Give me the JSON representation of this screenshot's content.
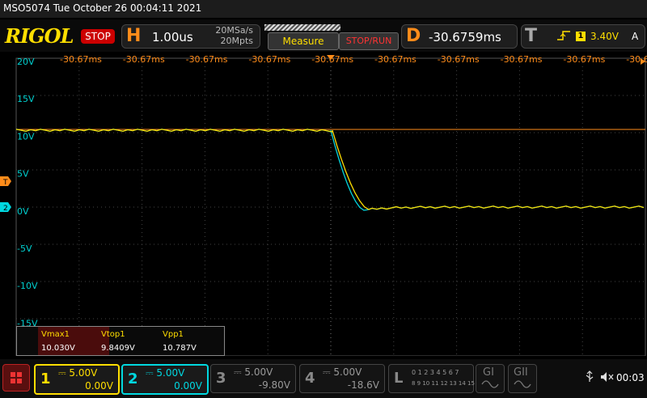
{
  "title": "MSO5074  Tue October 26 00:04:11 2021",
  "brand": "RIGOL",
  "run_state": "STOP",
  "horizontal": {
    "letter": "H",
    "timebase": "1.00us",
    "sample_rate": "20MSa/s",
    "memory_depth": "20Mpts"
  },
  "buttons": {
    "measure": "Measure",
    "stop_run": "STOP/RUN"
  },
  "delay": {
    "letter": "D",
    "value": "-30.6759ms"
  },
  "trigger": {
    "letter": "T",
    "edge_icon": "rising-edge-icon",
    "source": "1",
    "level": "3.40V",
    "mode": "A"
  },
  "time_labels": [
    "-30.67ms",
    "-30.67ms",
    "-30.67ms",
    "-30.67ms",
    "-30.67ms",
    "-30.67ms",
    "-30.67ms",
    "-30.67ms",
    "-30.67ms",
    "-30.67ms"
  ],
  "volt_labels": [
    "20V",
    "15V",
    "10V",
    "5V",
    "0V",
    "-5V",
    "-10V",
    "-15V"
  ],
  "markers": {
    "trigger": "T",
    "ch2": "2"
  },
  "measurements": {
    "headers": [
      "Vmax1",
      "Vtop1",
      "Vpp1"
    ],
    "values": [
      "10.030V",
      "9.8409V",
      "10.787V"
    ]
  },
  "channels": [
    {
      "num": "1",
      "scale": "5.00V",
      "offset": "0.00V",
      "color": "#ffde00",
      "active": true
    },
    {
      "num": "2",
      "scale": "5.00V",
      "offset": "0.00V",
      "color": "#00d8e0",
      "active": true
    },
    {
      "num": "3",
      "scale": "5.00V",
      "offset": "-9.80V",
      "color": "#9a9a9a",
      "active": false
    },
    {
      "num": "4",
      "scale": "5.00V",
      "offset": "-18.6V",
      "color": "#9a9a9a",
      "active": false
    }
  ],
  "logic": {
    "letter": "L",
    "row1": "0 1 2 3 4 5 6 7",
    "row2": "8 9 10 11 12 13 14 15"
  },
  "generators": [
    "GI",
    "GII"
  ],
  "clock": "00:03",
  "colors": {
    "ch1": "#ffde00",
    "ch2": "#00d8e0",
    "trigger": "#ff8c1a",
    "stop": "#cc0000"
  }
}
